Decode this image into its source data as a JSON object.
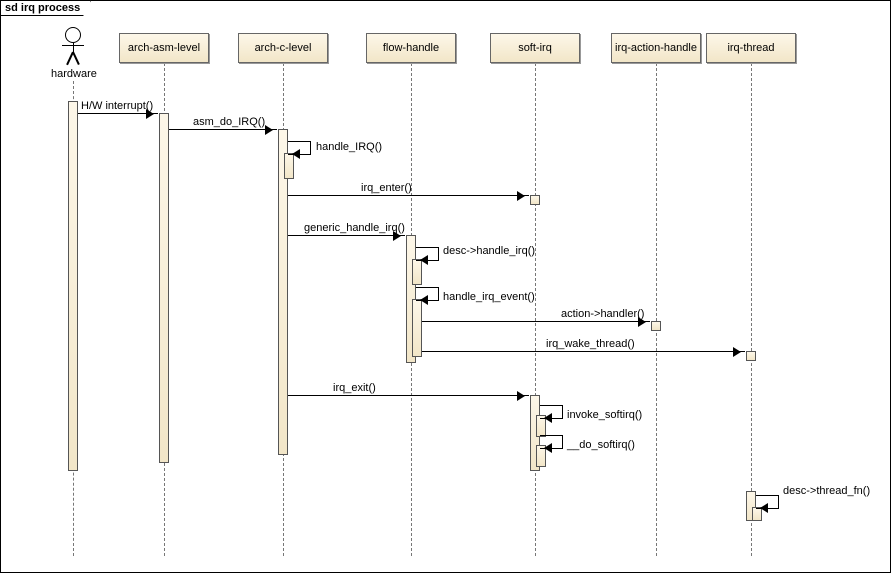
{
  "frame_title": "sd irq process",
  "actor": {
    "name": "hardware"
  },
  "participants": {
    "asm": "arch-asm-level",
    "c": "arch-c-level",
    "flow": "flow-handle",
    "soft": "soft-irq",
    "act": "irq-action-handle",
    "thr": "irq-thread"
  },
  "messages": {
    "m1": "H/W interrupt()",
    "m2": "asm_do_IRQ()",
    "m3": "handle_IRQ()",
    "m4": "irq_enter()",
    "m5": "generic_handle_irq()",
    "m6": "desc->handle_irq()",
    "m7": "handle_irq_event()",
    "m8": "action->handler()",
    "m9": "irq_wake_thread()",
    "m10": "irq_exit()",
    "m11": "invoke_softirq()",
    "m12": "__do_softirq()",
    "m13": "desc->thread_fn()"
  },
  "chart_data": {
    "type": "sequence",
    "participants": [
      "hardware",
      "arch-asm-level",
      "arch-c-level",
      "flow-handle",
      "soft-irq",
      "irq-action-handle",
      "irq-thread"
    ],
    "messages": [
      {
        "from": "hardware",
        "to": "arch-asm-level",
        "label": "H/W interrupt()"
      },
      {
        "from": "arch-asm-level",
        "to": "arch-c-level",
        "label": "asm_do_IRQ()"
      },
      {
        "from": "arch-c-level",
        "to": "arch-c-level",
        "label": "handle_IRQ()"
      },
      {
        "from": "arch-c-level",
        "to": "soft-irq",
        "label": "irq_enter()"
      },
      {
        "from": "arch-c-level",
        "to": "flow-handle",
        "label": "generic_handle_irq()"
      },
      {
        "from": "flow-handle",
        "to": "flow-handle",
        "label": "desc->handle_irq()"
      },
      {
        "from": "flow-handle",
        "to": "flow-handle",
        "label": "handle_irq_event()"
      },
      {
        "from": "flow-handle",
        "to": "irq-action-handle",
        "label": "action->handler()"
      },
      {
        "from": "flow-handle",
        "to": "irq-thread",
        "label": "irq_wake_thread()"
      },
      {
        "from": "arch-c-level",
        "to": "soft-irq",
        "label": "irq_exit()"
      },
      {
        "from": "soft-irq",
        "to": "soft-irq",
        "label": "invoke_softirq()"
      },
      {
        "from": "soft-irq",
        "to": "soft-irq",
        "label": "__do_softirq()"
      },
      {
        "from": "irq-thread",
        "to": "irq-thread",
        "label": "desc->thread_fn()"
      }
    ]
  }
}
